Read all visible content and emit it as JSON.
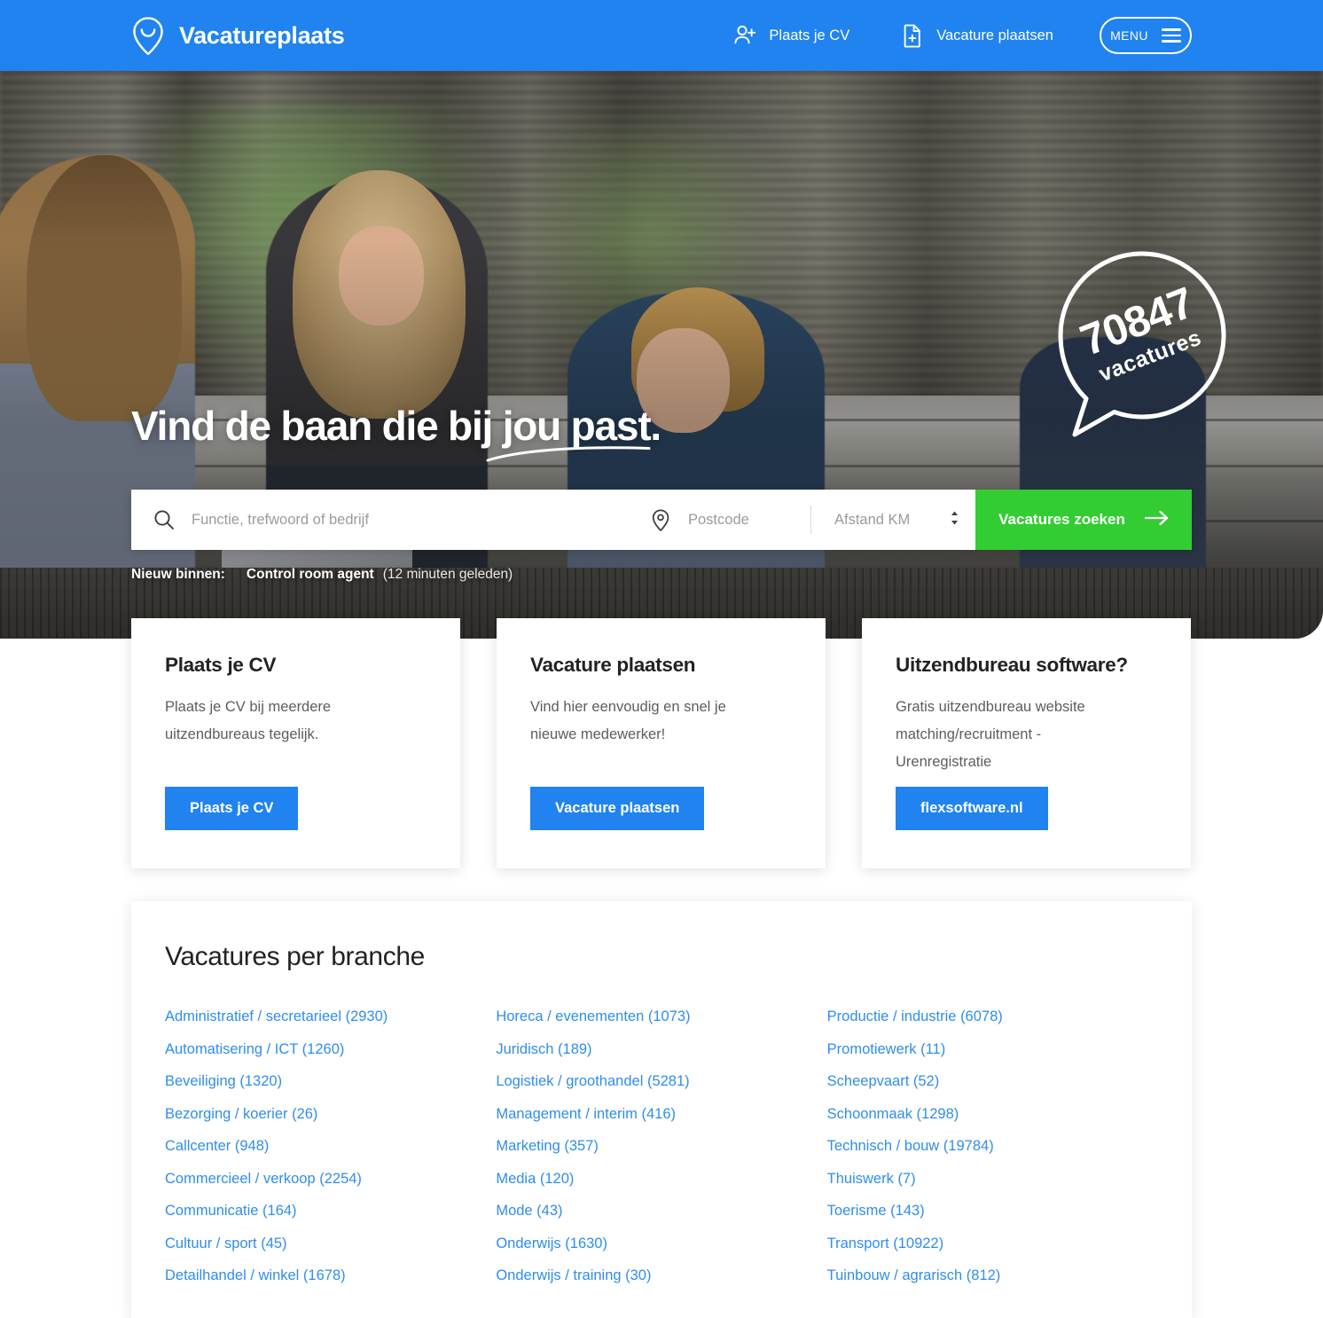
{
  "header": {
    "brand": "Vacatureplaats",
    "logo_icon": "map-pin-smile-icon",
    "nav": [
      {
        "label": "Plaats je CV",
        "icon": "user-plus-icon"
      },
      {
        "label": "Vacature plaatsen",
        "icon": "document-plus-icon"
      }
    ],
    "menu_label": "MENU",
    "menu_icon": "hamburger-icon",
    "bg_color": "#2083ef"
  },
  "hero": {
    "title": "Vind de baan die bij jou past.",
    "badge": {
      "count": "70847",
      "label": "vacatures",
      "icon": "map-pin-outline-icon"
    },
    "search": {
      "keyword_placeholder": "Functie, trefwoord of bedrijf",
      "keyword_value": "",
      "keyword_icon": "search-icon",
      "postcode_placeholder": "Postcode",
      "postcode_value": "",
      "postcode_icon": "location-pin-icon",
      "distance_label": "Afstand KM",
      "distance_icon": "select-updown-icon",
      "submit_label": "Vacatures zoeken",
      "submit_icon": "arrow-right-icon",
      "submit_color": "#33cc33"
    },
    "new_in": {
      "label": "Nieuw binnen:",
      "job": "Control room agent",
      "time": "(12 minuten geleden)"
    }
  },
  "promo_cards": [
    {
      "title": "Plaats je CV",
      "description": "Plaats je CV bij meerdere uitzendbureaus tegelijk.",
      "button": "Plaats je CV"
    },
    {
      "title": "Vacature plaatsen",
      "description": "Vind hier eenvoudig en snel je nieuwe medewerker!",
      "button": "Vacature plaatsen"
    },
    {
      "title": "Uitzendbureau software?",
      "description": "Gratis uitzendbureau website matching/recruitment - Urenregistratie",
      "button": "flexsoftware.nl"
    }
  ],
  "branches": {
    "title": "Vacatures per branche",
    "link_color": "#2f8ded",
    "columns": [
      [
        "Administratief / secretarieel (2930)",
        "Automatisering / ICT (1260)",
        "Beveiliging (1320)",
        "Bezorging / koerier (26)",
        "Callcenter (948)",
        "Commercieel / verkoop (2254)",
        "Communicatie (164)",
        "Cultuur / sport (45)",
        "Detailhandel / winkel (1678)"
      ],
      [
        "Horeca / evenementen (1073)",
        "Juridisch (189)",
        "Logistiek / groothandel (5281)",
        "Management / interim (416)",
        "Marketing (357)",
        "Media (120)",
        "Mode (43)",
        "Onderwijs (1630)",
        "Onderwijs / training (30)"
      ],
      [
        "Productie / industrie (6078)",
        "Promotiewerk (11)",
        "Scheepvaart (52)",
        "Schoonmaak (1298)",
        "Technisch / bouw (19784)",
        "Thuiswerk (7)",
        "Toerisme (143)",
        "Transport (10922)",
        "Tuinbouw / agrarisch (812)"
      ]
    ]
  }
}
